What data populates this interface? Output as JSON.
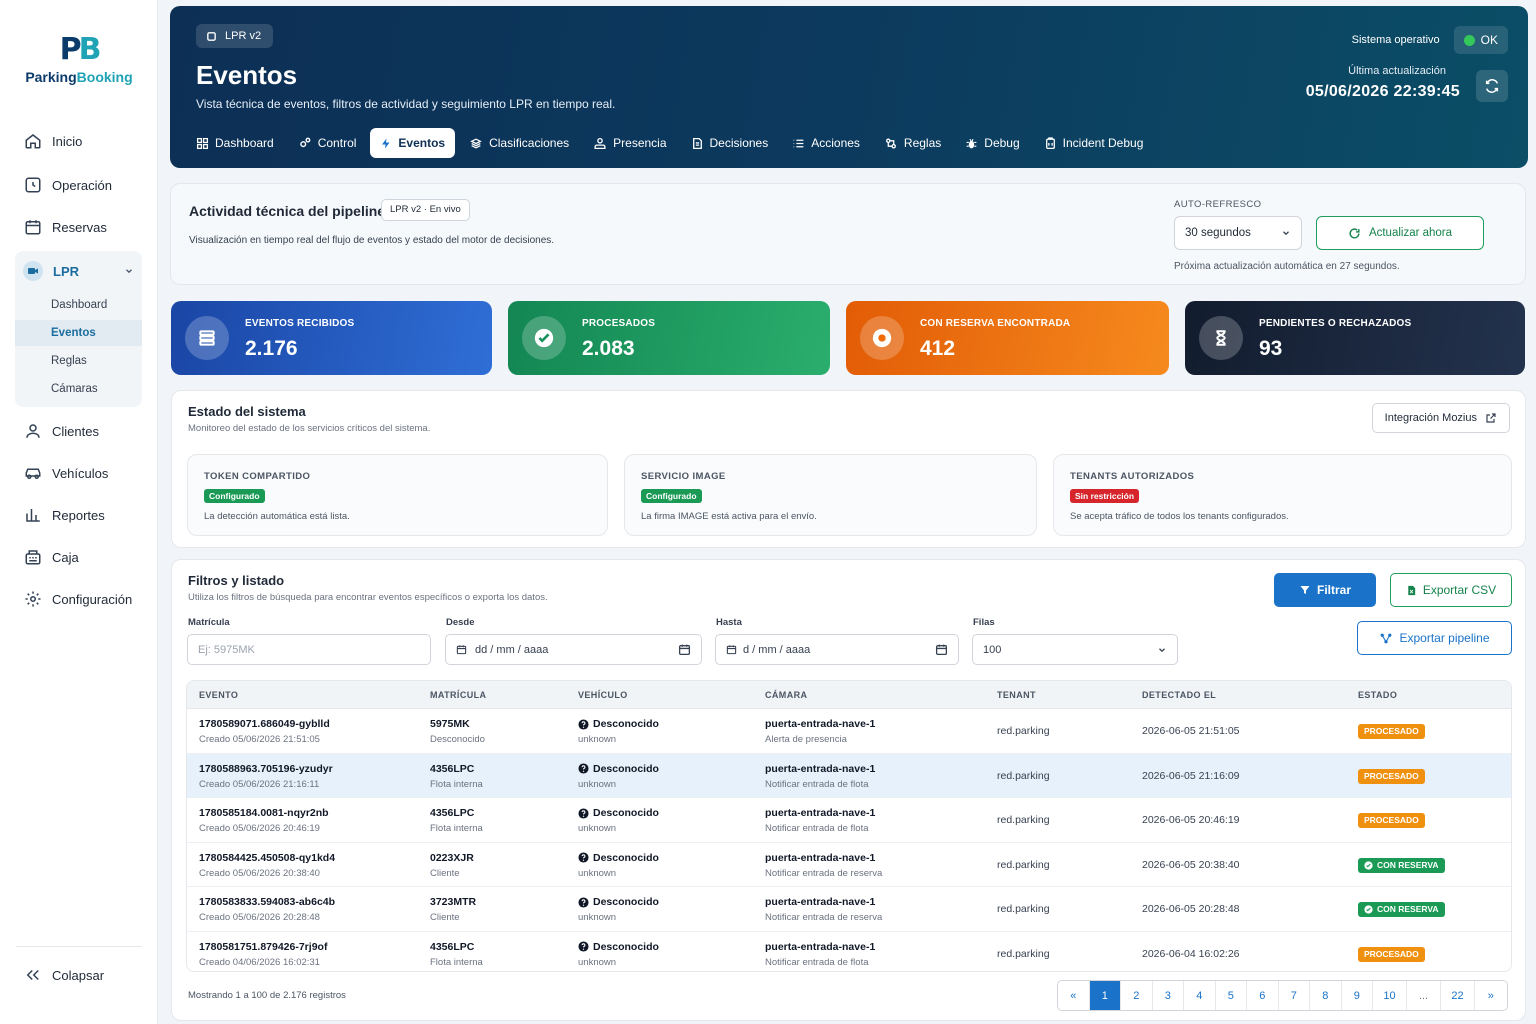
{
  "brand": {
    "mark_p": "P",
    "mark_b": "B",
    "name_a": "Parking",
    "name_b": "Booking"
  },
  "sidebar": {
    "items": [
      {
        "label": "Inicio"
      },
      {
        "label": "Operación"
      },
      {
        "label": "Reservas"
      },
      {
        "label": "Clientes"
      },
      {
        "label": "Vehículos"
      },
      {
        "label": "Reportes"
      },
      {
        "label": "Caja"
      },
      {
        "label": "Configuración"
      }
    ],
    "lpr": {
      "label": "LPR",
      "sub": [
        {
          "label": "Dashboard"
        },
        {
          "label": "Eventos"
        },
        {
          "label": "Reglas"
        },
        {
          "label": "Cámaras"
        }
      ]
    },
    "collapse": "Colapsar"
  },
  "hero": {
    "badge": "LPR v2",
    "title": "Eventos",
    "description": "Vista técnica de eventos, filtros de actividad y seguimiento LPR en tiempo real.",
    "system_status": "Sistema operativo",
    "ok": "OK",
    "update_label": "Última actualización",
    "update_time": "05/06/2026 22:39:45",
    "tabs": [
      {
        "label": "Dashboard"
      },
      {
        "label": "Control"
      },
      {
        "label": "Eventos"
      },
      {
        "label": "Clasificaciones"
      },
      {
        "label": "Presencia"
      },
      {
        "label": "Decisiones"
      },
      {
        "label": "Acciones"
      },
      {
        "label": "Reglas"
      },
      {
        "label": "Debug"
      },
      {
        "label": "Incident Debug"
      }
    ]
  },
  "pipeline": {
    "title": "Actividad técnica del pipeline",
    "live": "LPR v2 · En vivo",
    "description": "Visualización en tiempo real del flujo de eventos y estado del motor de decisiones.",
    "auto_label": "AUTO-REFRESCO",
    "interval": "30 segundos",
    "refresh_now": "Actualizar ahora",
    "next": "Próxima actualización automática en 27 segundos."
  },
  "stats": [
    {
      "label": "EVENTOS RECIBIDOS",
      "value": "2.176"
    },
    {
      "label": "PROCESADOS",
      "value": "2.083"
    },
    {
      "label": "CON RESERVA ENCONTRADA",
      "value": "412"
    },
    {
      "label": "PENDIENTES O RECHAZADOS",
      "value": "93"
    }
  ],
  "colors": {
    "stat_blue": "#1d4fb0",
    "stat_green": "#17915a",
    "stat_orange": "#ef6c0a",
    "stat_dark": "#16243a",
    "processed": "#f0900f",
    "reserved": "#1a9a55",
    "primary": "#1a73c8"
  },
  "system": {
    "title": "Estado del sistema",
    "subtitle": "Monitoreo del estado de los servicios críticos del sistema.",
    "integration": "Integración Mozius",
    "boxes": [
      {
        "title": "TOKEN COMPARTIDO",
        "tag": "Configurado",
        "note": "La detección automática está lista."
      },
      {
        "title": "SERVICIO IMAGE",
        "tag": "Configurado",
        "note": "La firma IMAGE está activa para el envío."
      },
      {
        "title": "TENANTS AUTORIZADOS",
        "tag": "Sin restricción",
        "note": "Se acepta tráfico de todos los tenants configurados."
      }
    ]
  },
  "filters": {
    "title": "Filtros y listado",
    "subtitle": "Utiliza los filtros de búsqueda para encontrar eventos específicos o exporta los datos.",
    "filter_btn": "Filtrar",
    "csv_btn": "Exportar CSV",
    "pipeline_btn": "Exportar pipeline",
    "plate_label": "Matrícula",
    "plate_placeholder": "Ej: 5975MK",
    "from_label": "Desde",
    "from_placeholder": "dd / mm / aaaa",
    "to_label": "Hasta",
    "to_placeholder": "d / mm / aaaa",
    "rows_label": "Filas",
    "rows_value": "100"
  },
  "table": {
    "headers": [
      "EVENTO",
      "MATRÍCULA",
      "VEHÍCULO",
      "CÁMARA",
      "TENANT",
      "DETECTADO EL",
      "ESTADO"
    ],
    "rows": [
      {
        "event": "1780589071.686049-gyblld",
        "created": "Creado 05/06/2026 21:51:05",
        "plate": "5975MK",
        "plate_type": "Desconocido",
        "vehicle": "Desconocido",
        "vehicle_sub": "unknown",
        "camera": "puerta-entrada-nave-1",
        "camera_sub": "Alerta de presencia",
        "tenant": "red.parking",
        "detected": "2026-06-05 21:51:05",
        "status": "PROCESADO"
      },
      {
        "event": "1780588963.705196-yzudyr",
        "created": "Creado 05/06/2026 21:16:11",
        "plate": "4356LPC",
        "plate_type": "Flota interna",
        "vehicle": "Desconocido",
        "vehicle_sub": "unknown",
        "camera": "puerta-entrada-nave-1",
        "camera_sub": "Notificar entrada de flota",
        "tenant": "red.parking",
        "detected": "2026-06-05 21:16:09",
        "status": "PROCESADO"
      },
      {
        "event": "1780585184.0081-nqyr2nb",
        "created": "Creado 05/06/2026 20:46:19",
        "plate": "4356LPC",
        "plate_type": "Flota interna",
        "vehicle": "Desconocido",
        "vehicle_sub": "unknown",
        "camera": "puerta-entrada-nave-1",
        "camera_sub": "Notificar entrada de flota",
        "tenant": "red.parking",
        "detected": "2026-06-05 20:46:19",
        "status": "PROCESADO"
      },
      {
        "event": "1780584425.450508-qy1kd4",
        "created": "Creado 05/06/2026 20:38:40",
        "plate": "0223XJR",
        "plate_type": "Cliente",
        "vehicle": "Desconocido",
        "vehicle_sub": "unknown",
        "camera": "puerta-entrada-nave-1",
        "camera_sub": "Notificar entrada de reserva",
        "tenant": "red.parking",
        "detected": "2026-06-05 20:38:40",
        "status": "CON RESERVA"
      },
      {
        "event": "1780583833.594083-ab6c4b",
        "created": "Creado 05/06/2026 20:28:48",
        "plate": "3723MTR",
        "plate_type": "Cliente",
        "vehicle": "Desconocido",
        "vehicle_sub": "unknown",
        "camera": "puerta-entrada-nave-1",
        "camera_sub": "Notificar entrada de reserva",
        "tenant": "red.parking",
        "detected": "2026-06-05 20:28:48",
        "status": "CON RESERVA"
      },
      {
        "event": "1780581751.879426-7rj9of",
        "created": "Creado 04/06/2026 16:02:31",
        "plate": "4356LPC",
        "plate_type": "Flota interna",
        "vehicle": "Desconocido",
        "vehicle_sub": "unknown",
        "camera": "puerta-entrada-nave-1",
        "camera_sub": "Notificar entrada de flota",
        "tenant": "red.parking",
        "detected": "2026-06-04 16:02:26",
        "status": "PROCESADO"
      }
    ],
    "footer": "Mostrando 1 a 100 de 2.176 registros",
    "pages": [
      "«",
      "1",
      "2",
      "3",
      "4",
      "5",
      "6",
      "7",
      "8",
      "9",
      "10",
      "...",
      "22",
      "»"
    ]
  }
}
